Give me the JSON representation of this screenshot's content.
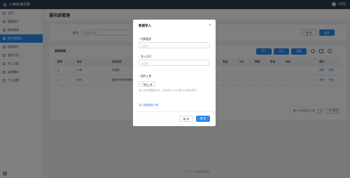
{
  "app": {
    "title": "小莱莉通讯录",
    "user": "小莱莉"
  },
  "sidebar": {
    "items": [
      {
        "label": "主页",
        "icon": "home-icon"
      },
      {
        "label": "管理用户",
        "icon": "user-icon"
      },
      {
        "label": "组织管理",
        "icon": "org-icon"
      },
      {
        "label": "通讯录管理",
        "icon": "contacts-icon",
        "active": true
      },
      {
        "label": "组织用户",
        "icon": "group-icon"
      },
      {
        "label": "登录日志",
        "icon": "log-icon"
      },
      {
        "label": "导入记录",
        "icon": "import-icon"
      },
      {
        "label": "反馈建议",
        "icon": "feedback-icon"
      },
      {
        "label": "个人设置",
        "icon": "settings-icon"
      }
    ]
  },
  "page": {
    "title": "通讯录管理"
  },
  "search": {
    "label": "姓名",
    "placeholder": "请输入姓名",
    "query_label": "查 询",
    "reset_label": "展开"
  },
  "table": {
    "title": "查询表格",
    "buttons": {
      "import": "导入",
      "export": "导出",
      "add": "新建"
    },
    "columns": [
      "编号",
      "姓名",
      "所在组织",
      "电话",
      "QQ",
      "邮箱",
      "职位",
      "地址",
      "操作"
    ],
    "rows": [
      {
        "id": "1",
        "name": "小杰",
        "org": "行政部",
        "phone": "-",
        "qq": "-",
        "email": "-",
        "position": "-",
        "address": "-",
        "edit": "编辑",
        "del": "删除"
      },
      {
        "id": "2",
        "name": "米可",
        "org": "重庆米可科技有限公司",
        "phone": "-",
        "qq": "-",
        "email": "-",
        "position": "-",
        "address": "-",
        "edit": "编辑",
        "del": "删除"
      }
    ],
    "pagination": {
      "summary": "第 1-2 条/总共 2 条",
      "current": "1",
      "page_size": "10 条/页"
    }
  },
  "footer": {
    "text": "© 2023 小莱莉通讯录"
  },
  "modal": {
    "title": "数据导入",
    "org_label": "所属组织",
    "org_placeholder": "请选择",
    "method_label": "导入方式",
    "method_placeholder": "请选择",
    "file_label": "附件上传",
    "upload_label": "单击上传",
    "upload_tip": "导入文件不能超过5M，仅允许导入\"xls\"或\"xlsx\"格式文件！",
    "template_link": "导入数据模板下载",
    "cancel_label": "取 消",
    "ok_label": "确 定"
  },
  "colors": {
    "primary": "#2d8cf0",
    "topbar": "#2d3a4b"
  }
}
